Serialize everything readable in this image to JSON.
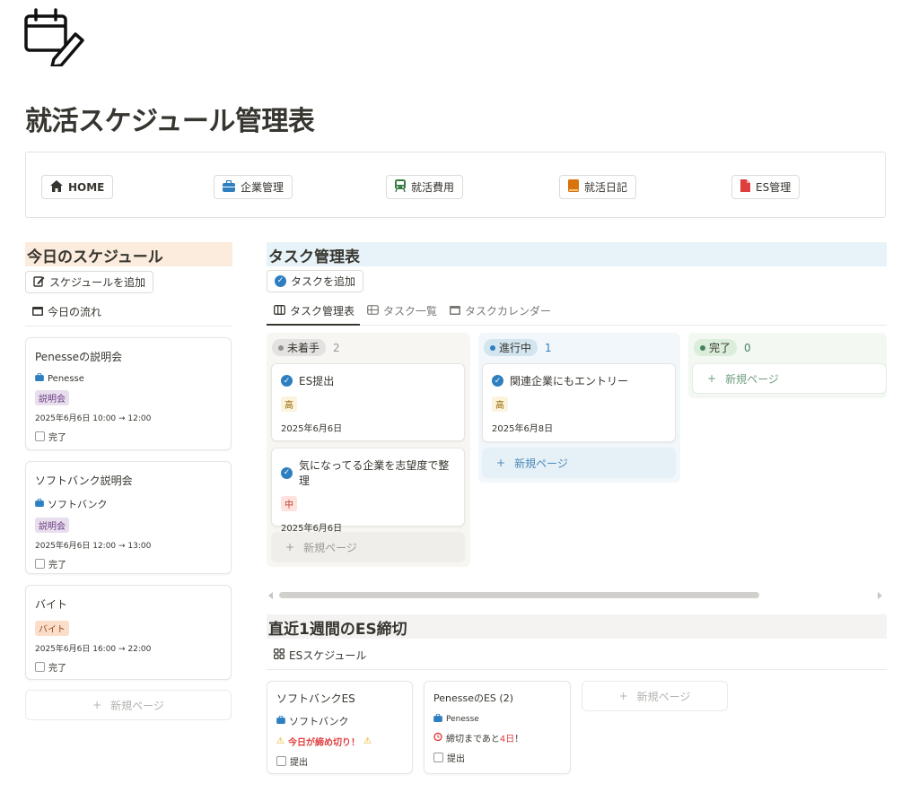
{
  "page": {
    "title": "就活スケジュール管理表",
    "icon": "calendar-edit-icon"
  },
  "nav": [
    {
      "label": "HOME",
      "icon": "home-icon",
      "color": "#37352f"
    },
    {
      "label": "企業管理",
      "icon": "briefcase-icon",
      "color": "#2e7fc0"
    },
    {
      "label": "就活費用",
      "icon": "train-icon",
      "color": "#3a7d44"
    },
    {
      "label": "就活日記",
      "icon": "notebook-icon",
      "color": "#d9730d"
    },
    {
      "label": "ES管理",
      "icon": "document-icon",
      "color": "#e03e3e"
    }
  ],
  "today": {
    "title": "今日のスケジュール",
    "add_button": "スケジュールを追加",
    "view_label": "今日の流れ",
    "items": [
      {
        "title": "Penesseの説明会",
        "company": "Penesse",
        "tag": "説明会",
        "time": "2025年6月6日 10:00 → 12:00",
        "done_label": "完了"
      },
      {
        "title": "ソフトバンク説明会",
        "company": "ソフトバンク",
        "tag": "説明会",
        "time": "2025年6月6日 12:00 → 13:00",
        "done_label": "完了"
      },
      {
        "title": "バイト",
        "tag": "バイト",
        "time": "2025年6月6日 16:00 → 22:00",
        "done_label": "完了"
      }
    ],
    "new_page": "新規ページ"
  },
  "tasks": {
    "title": "タスク管理表",
    "add_button": "タスクを追加",
    "tabs": [
      "タスク管理表",
      "タスク一覧",
      "タスクカレンダー"
    ],
    "columns": [
      {
        "status": "未着手",
        "count": "2",
        "cards": [
          {
            "title": "ES提出",
            "priority": "高",
            "date": "2025年6月6日"
          },
          {
            "title": "気になってる企業を志望度で整理",
            "priority": "中",
            "date": "2025年6月6日"
          }
        ]
      },
      {
        "status": "進行中",
        "count": "1",
        "cards": [
          {
            "title": "関連企業にもエントリー",
            "priority": "高",
            "date": "2025年6月8日"
          }
        ]
      },
      {
        "status": "完了",
        "count": "0",
        "cards": []
      }
    ],
    "new_page": "新規ページ"
  },
  "es": {
    "title": "直近1週間のES締切",
    "view_label": "ESスケジュール",
    "cards": [
      {
        "title": "ソフトバンクES",
        "company": "ソフトバンク",
        "deadline": "今日が締め切り！",
        "submit_label": "提出"
      },
      {
        "title": "PenesseのES (2)",
        "company": "Penesse",
        "deadline_prefix": "締切まであと",
        "deadline_days": "4日",
        "deadline_suffix": "！",
        "submit_label": "提出"
      }
    ],
    "new_page": "新規ページ"
  },
  "colors": {
    "tag_setsumeikai": "#e8deee",
    "tag_baito": "#fadec9",
    "priority_high": "#fbf3db",
    "priority_mid": "#ffe2dd",
    "status_todo": "#e3e2e0",
    "status_doing": "#d3e5ef",
    "status_done": "#dbeddb"
  }
}
